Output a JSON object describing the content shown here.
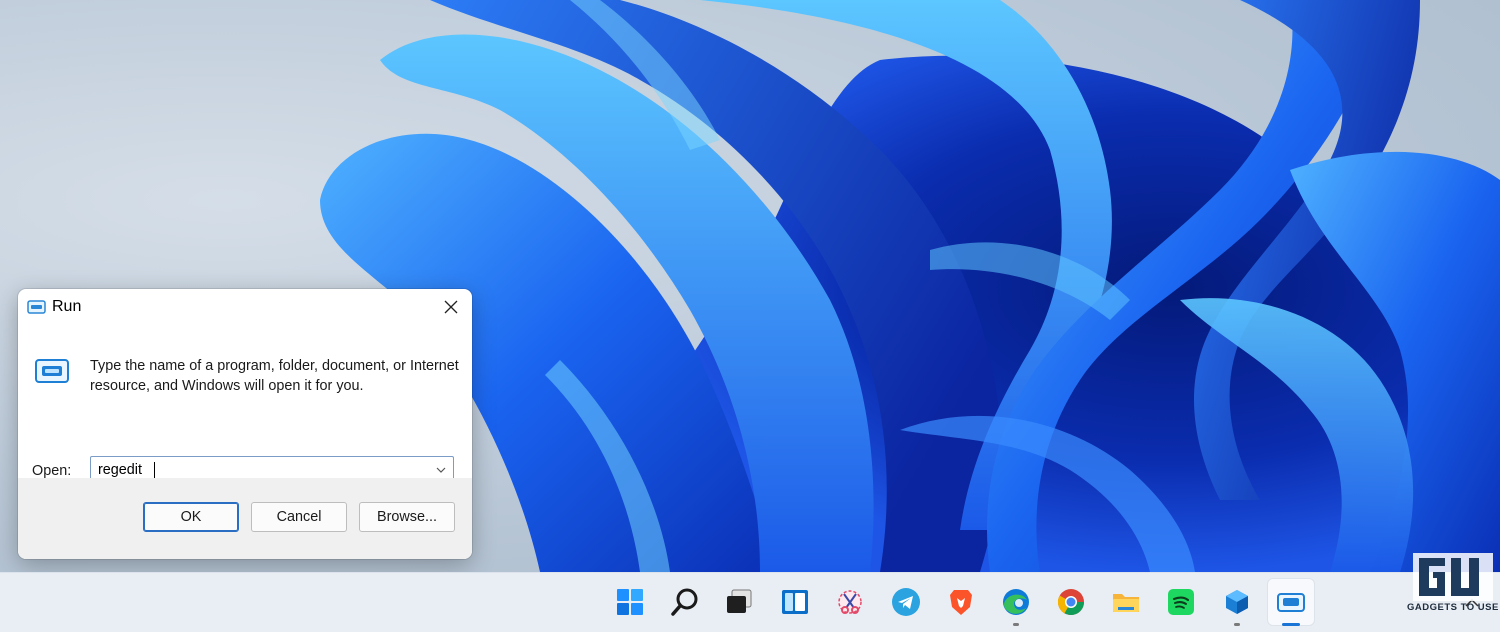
{
  "colors": {
    "desktop_bg": "#bac8d7",
    "accent": "#1a74d6",
    "dialog_footer": "#f0f0f0",
    "taskbar": "#e9eef5"
  },
  "run_dialog": {
    "title": "Run",
    "title_icon": "run-window-icon",
    "close_icon": "close-icon",
    "description": "Type the name of a program, folder, document, or Internet resource, and Windows will open it for you.",
    "open_label": "Open:",
    "open_value": "regedit",
    "dropdown_icon": "chevron-down-icon",
    "buttons": {
      "ok": "OK",
      "cancel": "Cancel",
      "browse": "Browse..."
    }
  },
  "taskbar": {
    "items": [
      {
        "name": "start",
        "icon": "windows-logo-icon"
      },
      {
        "name": "search",
        "icon": "search-icon"
      },
      {
        "name": "task-view",
        "icon": "task-view-icon"
      },
      {
        "name": "widgets",
        "icon": "widgets-icon"
      },
      {
        "name": "snipping-tool",
        "icon": "snipping-tool-icon"
      },
      {
        "name": "telegram",
        "icon": "telegram-icon"
      },
      {
        "name": "brave",
        "icon": "brave-icon"
      },
      {
        "name": "edge",
        "icon": "edge-icon",
        "running": true
      },
      {
        "name": "chrome",
        "icon": "chrome-icon"
      },
      {
        "name": "file-explorer",
        "icon": "folder-icon"
      },
      {
        "name": "spotify",
        "icon": "spotify-icon"
      },
      {
        "name": "sandbox",
        "icon": "cube-icon",
        "running": true
      },
      {
        "name": "run",
        "icon": "run-window-icon",
        "active": true
      }
    ],
    "tray_icon": "chevron-up-icon"
  },
  "watermark": {
    "logo": "gadgets-to-use-logo",
    "text": "GADGETS TO USE"
  }
}
